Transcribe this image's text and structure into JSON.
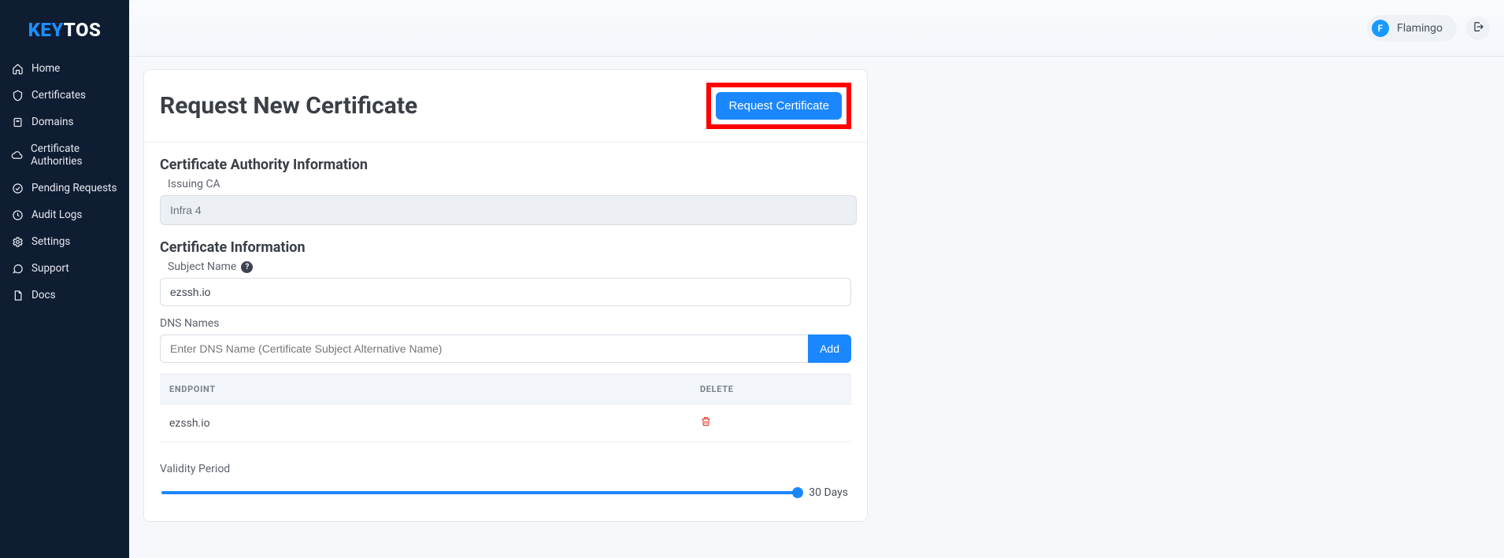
{
  "brand": {
    "left": "KEY",
    "right": "TOS"
  },
  "sidebar": {
    "items": [
      {
        "label": "Home"
      },
      {
        "label": "Certificates"
      },
      {
        "label": "Domains"
      },
      {
        "label": "Certificate Authorities"
      },
      {
        "label": "Pending Requests"
      },
      {
        "label": "Audit Logs"
      },
      {
        "label": "Settings"
      },
      {
        "label": "Support"
      },
      {
        "label": "Docs"
      }
    ]
  },
  "topbar": {
    "avatar_initial": "F",
    "user_name": "Flamingo"
  },
  "page": {
    "title": "Request New Certificate",
    "request_btn": "Request Certificate",
    "ca_section_title": "Certificate Authority Information",
    "issuing_ca_label": "Issuing CA",
    "issuing_ca_value": "Infra 4",
    "cert_info_title": "Certificate Information",
    "subject_label": "Subject Name",
    "subject_value": "ezssh.io",
    "dns_label": "DNS Names",
    "dns_placeholder": "Enter DNS Name (Certificate Subject Alternative Name)",
    "add_btn": "Add",
    "table": {
      "col_endpoint": "ENDPOINT",
      "col_delete": "DELETE",
      "rows": [
        {
          "endpoint": "ezssh.io"
        }
      ]
    },
    "validity_label": "Validity Period",
    "validity_value": "30 Days"
  }
}
